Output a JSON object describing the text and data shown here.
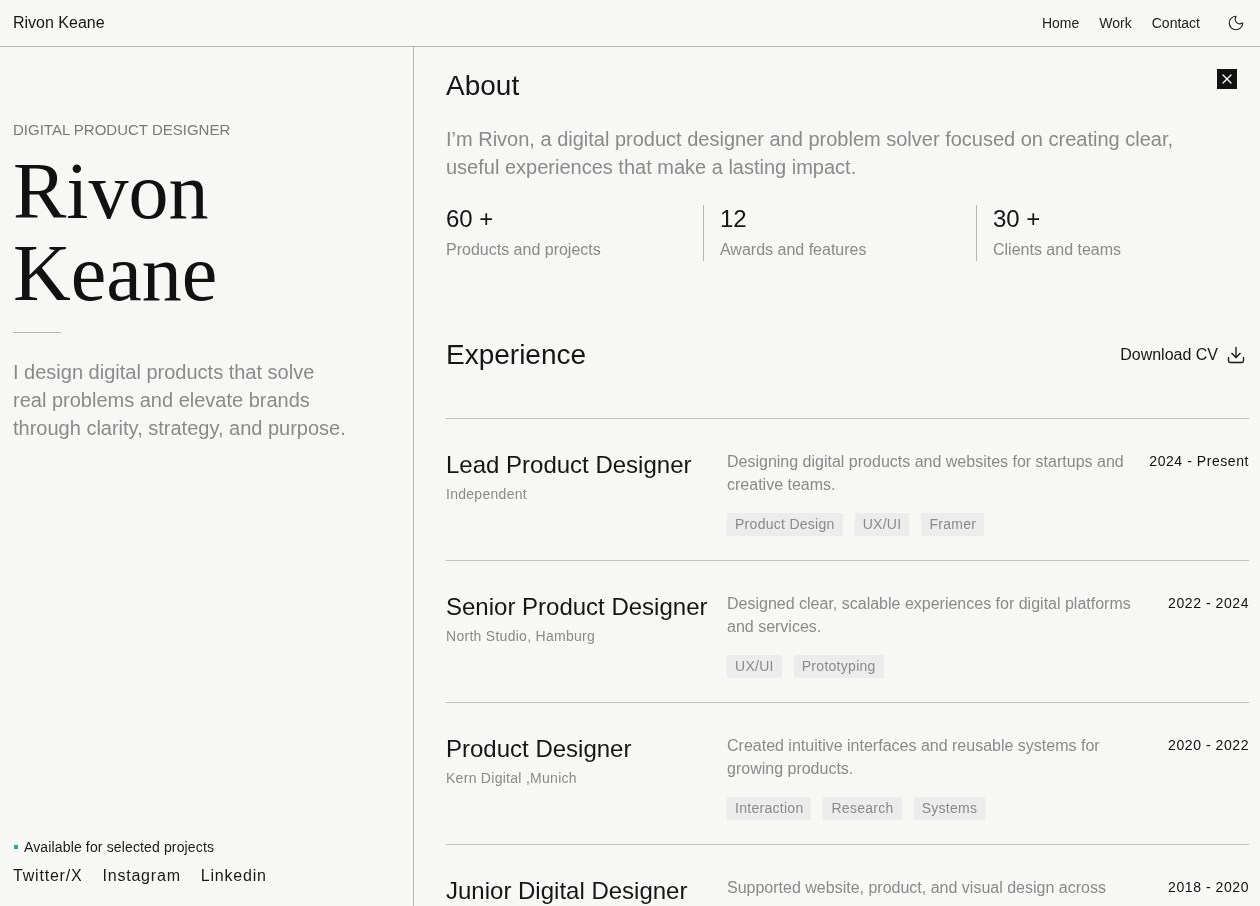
{
  "header": {
    "brand": "Rivon Keane",
    "nav": [
      "Home",
      "Work",
      "Contact"
    ]
  },
  "profile": {
    "eyebrow": "DIGITAL PRODUCT DESIGNER",
    "name": "Rivon Keane",
    "bio": "I design digital products that solve real problems and elevate brands through clarity, strategy, and purpose.",
    "availability": "Available for selected projects",
    "socials": [
      "Twitter/X",
      "Instagram",
      "Linkedin"
    ]
  },
  "about": {
    "title": "About",
    "intro": "I’m Rivon, a digital product designer and problem solver focused on creating clear, useful experiences that make a lasting impact.",
    "stats": [
      {
        "value": "60 +",
        "label": "Products and projects"
      },
      {
        "value": "12",
        "label": "Awards and features"
      },
      {
        "value": "30 +",
        "label": "Clients and teams"
      }
    ]
  },
  "experience": {
    "title": "Experience",
    "download": "Download CV",
    "jobs": [
      {
        "title": "Lead Product Designer",
        "company": "Independent",
        "description": "Designing digital products and websites for startups and creative teams.",
        "tags": [
          "Product Design",
          "UX/UI",
          "Framer"
        ],
        "period": "2024 - Present"
      },
      {
        "title": "Senior Product Designer",
        "company": "North Studio, Hamburg",
        "description": "Designed clear, scalable experiences for digital platforms and services.",
        "tags": [
          "UX/UI",
          "Prototyping"
        ],
        "period": "2022 - 2024"
      },
      {
        "title": "Product Designer",
        "company": "Kern Digital ,Munich",
        "description": "Created intuitive interfaces and reusable systems for growing products.",
        "tags": [
          "Interaction",
          "Research",
          "Systems"
        ],
        "period": "2020 - 2022"
      },
      {
        "title": "Junior Digital Designer",
        "description": "Supported website, product, and visual design across",
        "period": "2018 - 2020"
      }
    ]
  }
}
